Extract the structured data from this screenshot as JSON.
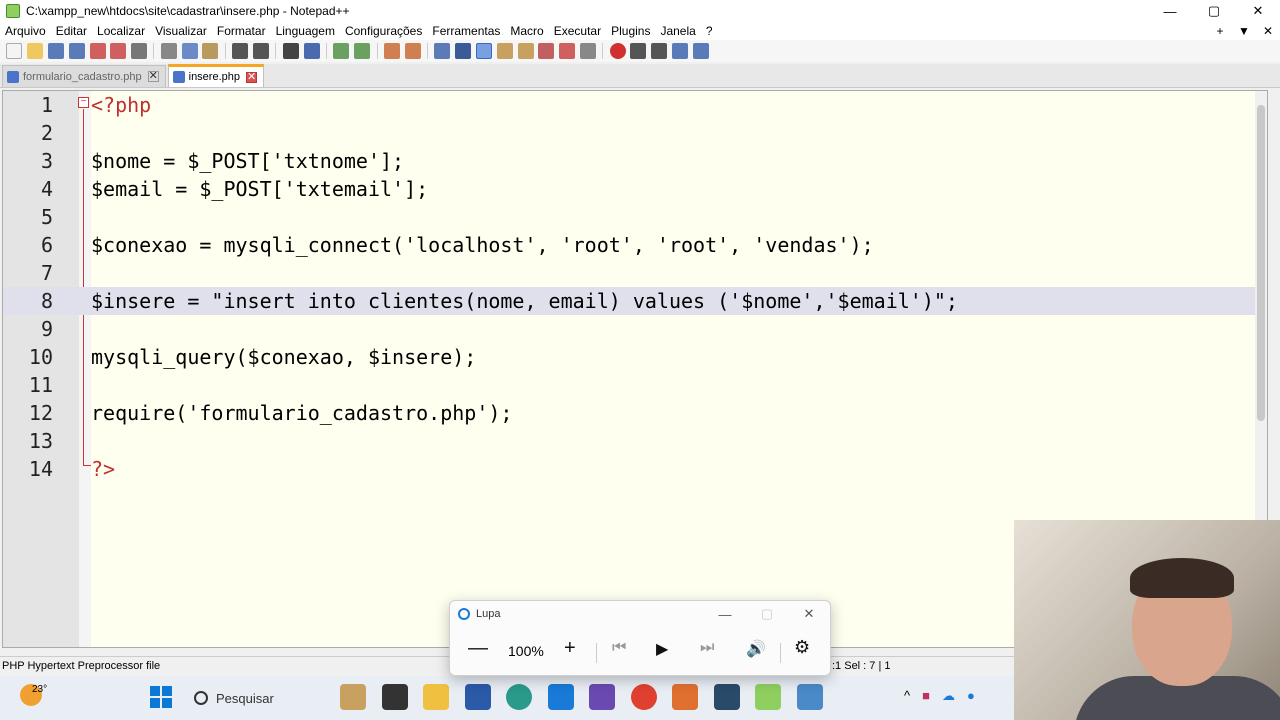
{
  "window": {
    "title": "C:\\xampp_new\\htdocs\\site\\cadastrar\\insere.php - Notepad++",
    "controls": {
      "minimize": "—",
      "maximize": "▢",
      "close": "✕"
    }
  },
  "menu": {
    "items": [
      "Arquivo",
      "Editar",
      "Localizar",
      "Visualizar",
      "Formatar",
      "Linguagem",
      "Configurações",
      "Ferramentas",
      "Macro",
      "Executar",
      "Plugins",
      "Janela",
      "?"
    ],
    "right": [
      "+",
      "▼",
      "✕"
    ]
  },
  "tabs": [
    {
      "label": "formulario_cadastro.php",
      "active": false
    },
    {
      "label": "insere.php",
      "active": true
    }
  ],
  "editor": {
    "lines": [
      {
        "num": "1",
        "text": "<?php"
      },
      {
        "num": "2",
        "text": ""
      },
      {
        "num": "3",
        "text": "$nome = $_POST['txtnome'];"
      },
      {
        "num": "4",
        "text": "$email = $_POST['txtemail'];"
      },
      {
        "num": "5",
        "text": ""
      },
      {
        "num": "6",
        "text": "$conexao = mysqli_connect('localhost', 'root', 'root', 'vendas');"
      },
      {
        "num": "7",
        "text": ""
      },
      {
        "num": "8",
        "text": "$insere = \"insert into clientes(nome, email) values ('$nome','$email')\";"
      },
      {
        "num": "9",
        "text": ""
      },
      {
        "num": "10",
        "text": "mysqli_query($conexao, $insere);"
      },
      {
        "num": "11",
        "text": ""
      },
      {
        "num": "12",
        "text": "require('formulario_cadastro.php');"
      },
      {
        "num": "13",
        "text": ""
      },
      {
        "num": "14",
        "text": "?>"
      }
    ],
    "highlighted_line": "8",
    "selection": "$insere"
  },
  "status": {
    "filetype": "PHP Hypertext Preprocessor file",
    "position": ":1    Sel : 7 | 1"
  },
  "lupa": {
    "title": "Lupa",
    "zoom": "100%",
    "minus": "—",
    "plus": "+"
  },
  "taskbar": {
    "weather_temp": "23°",
    "search_placeholder": "Pesquisar"
  },
  "colors": {
    "editor_bg": "#fffff0",
    "current_line": "#e0e0ec",
    "tab_accent": "#f5a623",
    "fold_marker": "#cc3333"
  }
}
